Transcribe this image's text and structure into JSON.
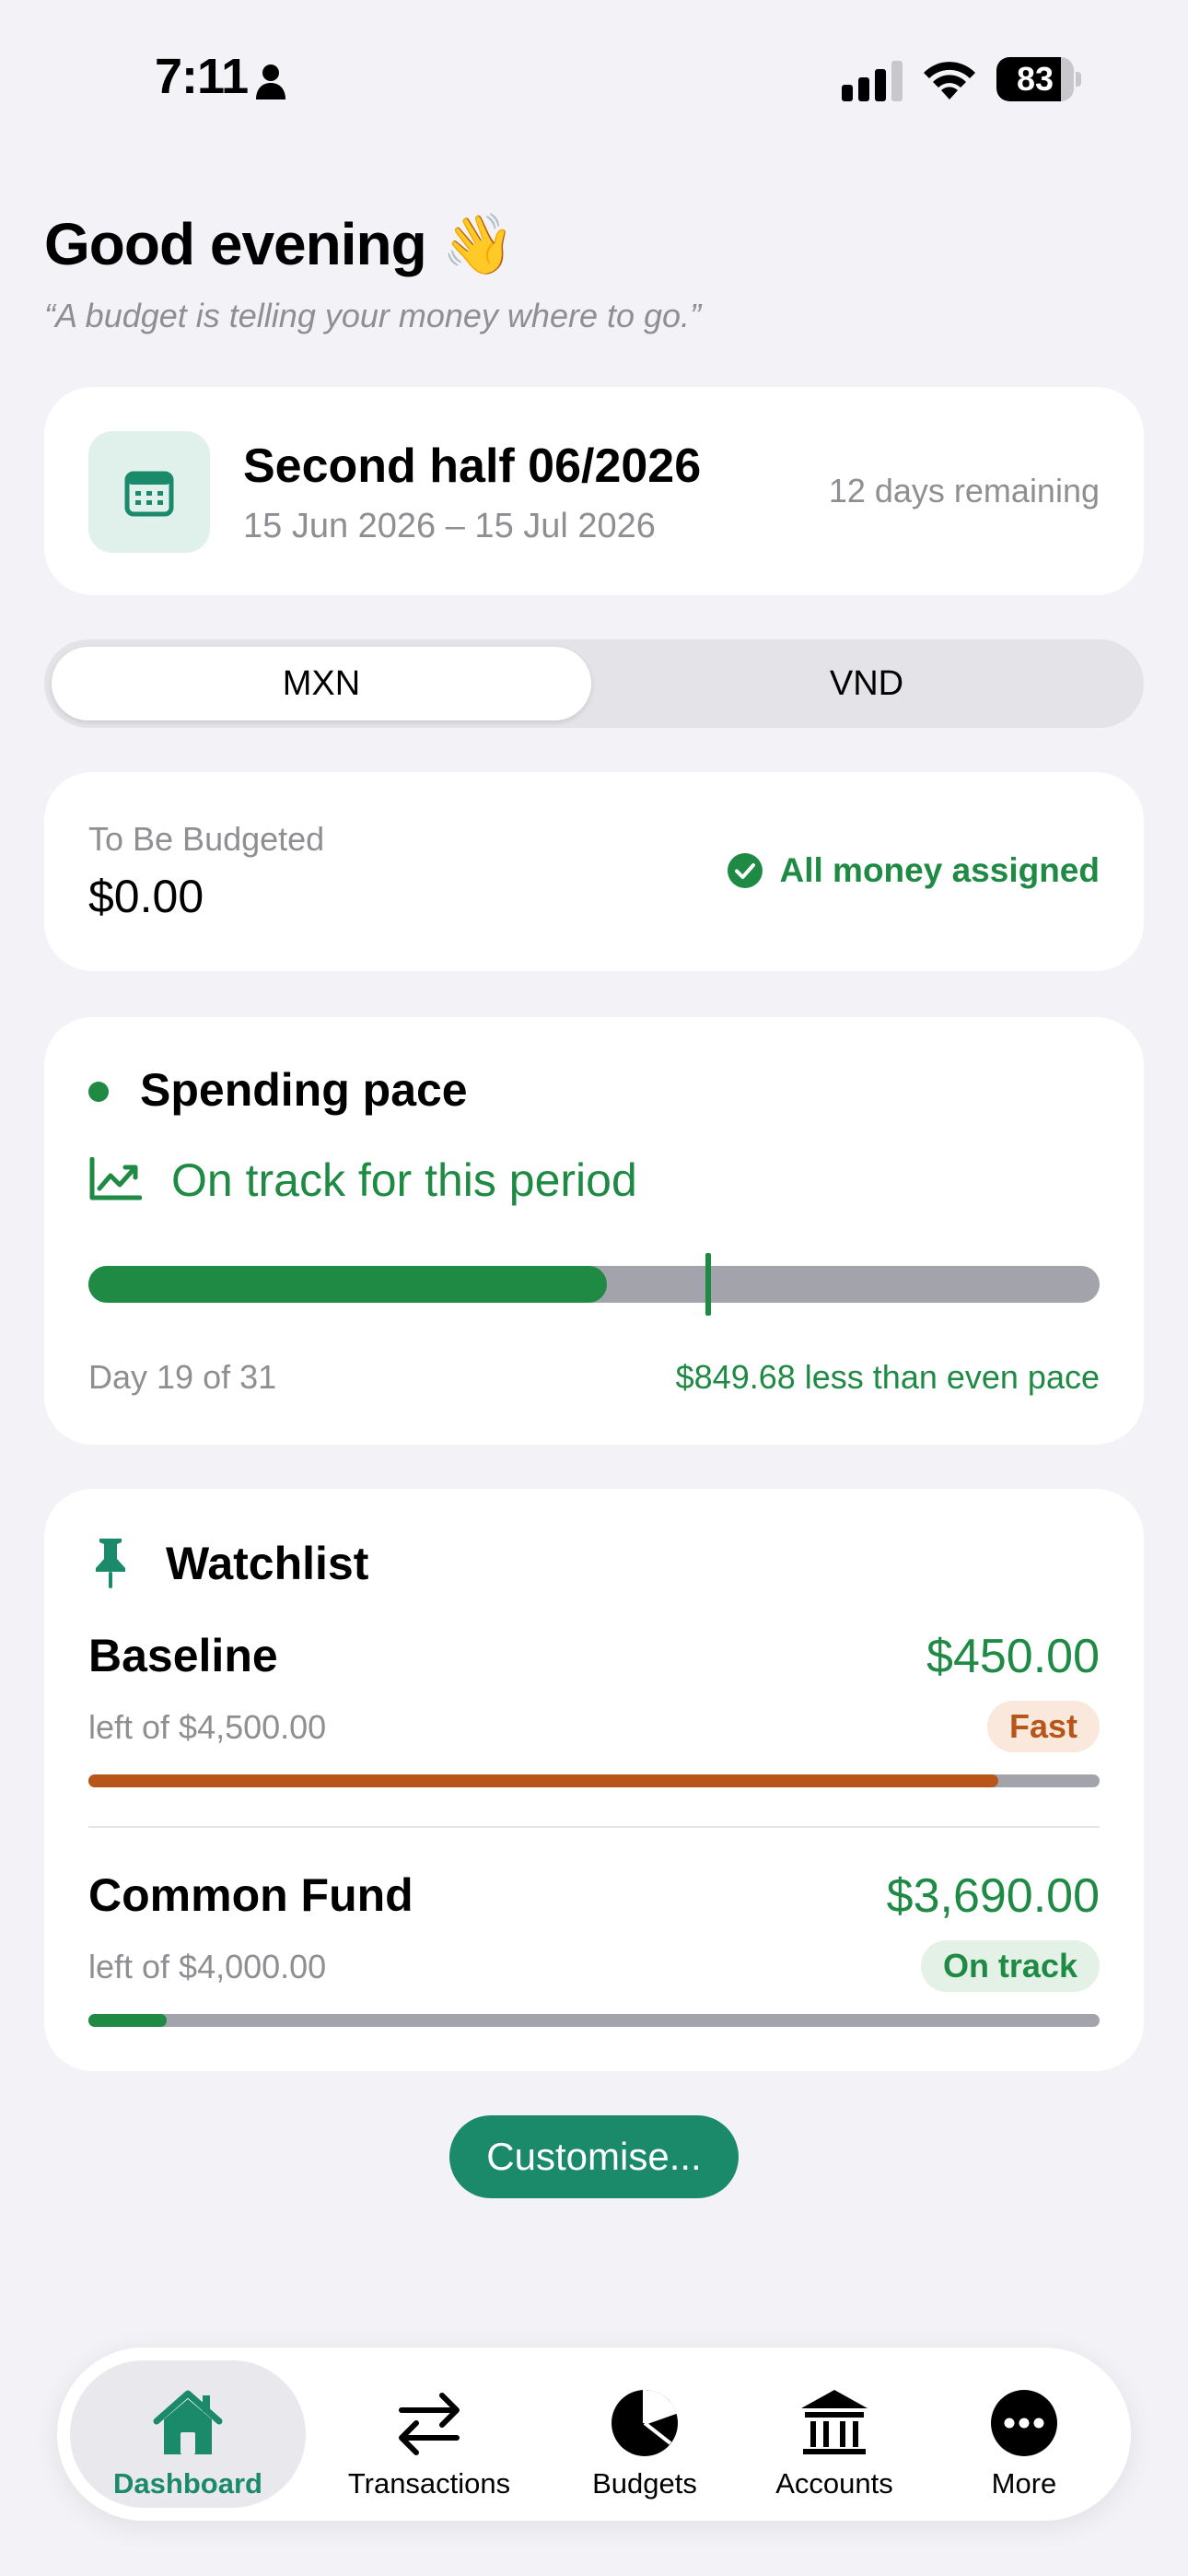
{
  "status_bar": {
    "time": "7:11",
    "battery": "83",
    "battery_level": 0.83
  },
  "header": {
    "greeting": "Good evening 👋",
    "quote": "“A budget is telling your money where to go.”"
  },
  "period": {
    "title": "Second half 06/2026",
    "range": "15 Jun 2026 – 15 Jul 2026",
    "remaining": "12 days remaining"
  },
  "currency_toggle": {
    "options": [
      "MXN",
      "VND"
    ],
    "selected": "MXN"
  },
  "to_be_budgeted": {
    "label": "To Be Budgeted",
    "value": "$0.00",
    "status": "All money assigned"
  },
  "spending_pace": {
    "title": "Spending pace",
    "status": "On track for this period",
    "day_text": "Day 19 of 31",
    "diff_text": "$849.68 less than even pace",
    "spent_fraction": 0.513,
    "even_pace_fraction": 0.613
  },
  "watchlist": {
    "title": "Watchlist",
    "items": [
      {
        "name": "Baseline",
        "amount": "$450.00",
        "sub": "left of $4,500.00",
        "badge": "Fast",
        "badge_type": "fast",
        "spent_fraction": 0.9,
        "color": "#b8561a"
      },
      {
        "name": "Common Fund",
        "amount": "$3,690.00",
        "sub": "left of $4,000.00",
        "badge": "On track",
        "badge_type": "ontrack",
        "spent_fraction": 0.077,
        "color": "#1e8a44"
      }
    ]
  },
  "customise_label": "Customise...",
  "tabs": [
    {
      "label": "Dashboard",
      "icon": "house-icon",
      "active": true
    },
    {
      "label": "Transactions",
      "icon": "arrows-icon",
      "active": false
    },
    {
      "label": "Budgets",
      "icon": "pie-icon",
      "active": false
    },
    {
      "label": "Accounts",
      "icon": "bank-icon",
      "active": false
    },
    {
      "label": "More",
      "icon": "ellipsis-icon",
      "active": false
    }
  ],
  "colors": {
    "accent": "#1a8a6a",
    "positive": "#1e8a44",
    "warning": "#b8561a",
    "track": "#a3a3ab",
    "background": "#f2f2f7"
  }
}
